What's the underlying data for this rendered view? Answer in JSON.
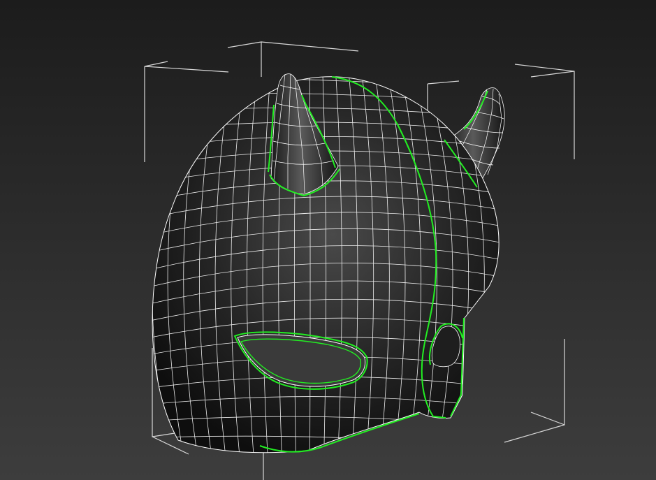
{
  "viewport": {
    "background_top": "#1c1c1c",
    "background_bottom": "#3d3d3d",
    "wire_color": "#ffffff",
    "selection_color": "#22ee22",
    "shade_light": "#4a4a4a",
    "shade_dark": "#0e0e0e",
    "eye_fill": "#3a3a3a"
  },
  "scene": {
    "object": "devil-mask-mesh",
    "display_mode": "shaded-with-edged-faces",
    "selected_edge_loops": [
      "center-seam",
      "left-horn-base",
      "right-horn-base",
      "eye-hole",
      "side-opening",
      "bottom-rim"
    ],
    "selection_bracket": "visible"
  }
}
